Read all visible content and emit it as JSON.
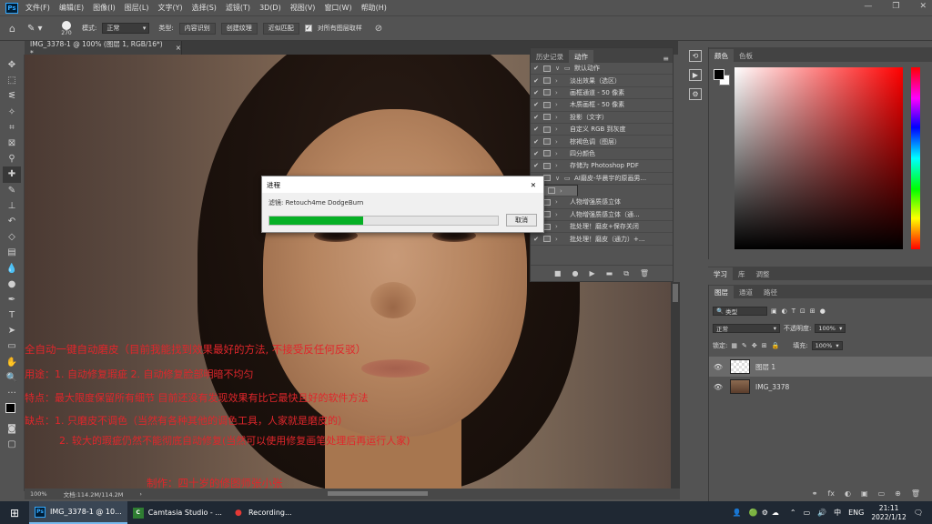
{
  "menubar": {
    "logo": "Ps",
    "items": [
      "文件(F)",
      "编辑(E)",
      "图像(I)",
      "图层(L)",
      "文字(Y)",
      "选择(S)",
      "滤镜(T)",
      "3D(D)",
      "视图(V)",
      "窗口(W)",
      "帮助(H)"
    ],
    "win_min": "—",
    "win_max": "❐",
    "win_close": "✕"
  },
  "options": {
    "brush_size": "270",
    "mode_label": "模式:",
    "mode_value": "正常",
    "type_label": "类型:",
    "btn_content_aware": "内容识别",
    "btn_create_texture": "创建纹理",
    "btn_proximity": "近似匹配",
    "sample_all_label": "对所有图层取样"
  },
  "document": {
    "tab_title": "IMG_3378-1 @ 100% (图层 1, RGB/16*) *",
    "tab_close": "×",
    "zoom": "100%",
    "doc_size": "文档:114.2M/114.2M"
  },
  "overlay_text": [
    "全自动一键自动磨皮（目前我能找到效果最好的方法, 不接受反任何反驳）",
    "用途：1. 自动修复瑕疵 2. 自动修复脸部明暗不均匀",
    "特点：最大限度保留所有细节 目前还没有发现效果有比它最快且好的软件方法",
    "缺点：1. 只磨皮不调色（当然有各种其他的调色工具，人家就是磨皮的）",
    "2. 较大的瑕疵仍然不能彻底自动修复(当然可以使用修复画笔处理后再运行人家)",
    "制作：四十岁的修图师张小张"
  ],
  "actions_panel": {
    "tab_history": "历史记录",
    "tab_actions": "动作",
    "rows": [
      {
        "indent": "∨",
        "folder": true,
        "name": "默认动作",
        "selected": false
      },
      {
        "indent": "›",
        "folder": false,
        "name": "淡出效果（选区）",
        "selected": false
      },
      {
        "indent": "›",
        "folder": false,
        "name": "画框通道 - 50 像素",
        "selected": false
      },
      {
        "indent": "›",
        "folder": false,
        "name": "木质画框 - 50 像素",
        "selected": false
      },
      {
        "indent": "›",
        "folder": false,
        "name": "投影（文字）",
        "selected": false
      },
      {
        "indent": "›",
        "folder": false,
        "name": "自定义 RGB 到灰度",
        "selected": false
      },
      {
        "indent": "›",
        "folder": false,
        "name": "棕褐色调（图层）",
        "selected": false
      },
      {
        "indent": "›",
        "folder": false,
        "name": "四分颜色",
        "selected": false
      },
      {
        "indent": "›",
        "folder": false,
        "name": "存储为 Photoshop PDF",
        "selected": false
      },
      {
        "indent": "∨",
        "folder": true,
        "name": "AI磨皮-华晨宇的原画男...",
        "selected": false
      },
      {
        "indent": "›",
        "folder": false,
        "name": "AI磨皮+修瑕",
        "selected": true
      },
      {
        "indent": "›",
        "folder": false,
        "name": "人物增强质感立体",
        "selected": false
      },
      {
        "indent": "›",
        "folder": false,
        "name": "人物增强质感立体（通...",
        "selected": false
      },
      {
        "indent": "›",
        "folder": false,
        "name": "批处理！磨皮+保存关闭",
        "selected": false
      },
      {
        "indent": "›",
        "folder": false,
        "name": "批处理！磨皮（通力）+...",
        "selected": false
      }
    ],
    "footer": [
      "■",
      "●",
      "▶",
      "▬",
      "⧉",
      "🗑"
    ]
  },
  "color_panel": {
    "tab_color": "颜色",
    "tab_swatches": "色板"
  },
  "learn_tabs": [
    "学习",
    "库",
    "调整"
  ],
  "layers_panel": {
    "tab_layers": "图层",
    "tab_channels": "通道",
    "tab_paths": "路径",
    "filter_kind": "类型",
    "blend_mode": "正常",
    "opacity_label": "不透明度:",
    "opacity_value": "100%",
    "lock_label": "锁定:",
    "fill_label": "填充:",
    "fill_value": "100%",
    "layers": [
      {
        "name": "图层 1",
        "selected": true
      },
      {
        "name": "IMG_3378",
        "selected": false
      }
    ],
    "footer": [
      "fx",
      "◐",
      "▣",
      "▭",
      "⊕",
      "🗑"
    ]
  },
  "dialog": {
    "title": "进程",
    "close": "✕",
    "subtitle": "滤镜: Retouch4me DodgeBurn",
    "progress_fraction": 0.41,
    "cancel_label": "取消"
  },
  "taskbar": {
    "items": [
      {
        "icon": "Ps",
        "label": "IMG_3378-1 @ 10...",
        "active": true
      },
      {
        "icon": "C",
        "label": "Camtasia Studio - ...",
        "active": false
      },
      {
        "icon": "●",
        "label": "Recording...",
        "active": false
      }
    ],
    "lang": "ENG",
    "time": "21:11",
    "date": "2022/1/12"
  },
  "colors": {
    "accent_ps": "#31a8ff",
    "overlay_red": "#e0262b",
    "progress_green": "#06b025"
  }
}
